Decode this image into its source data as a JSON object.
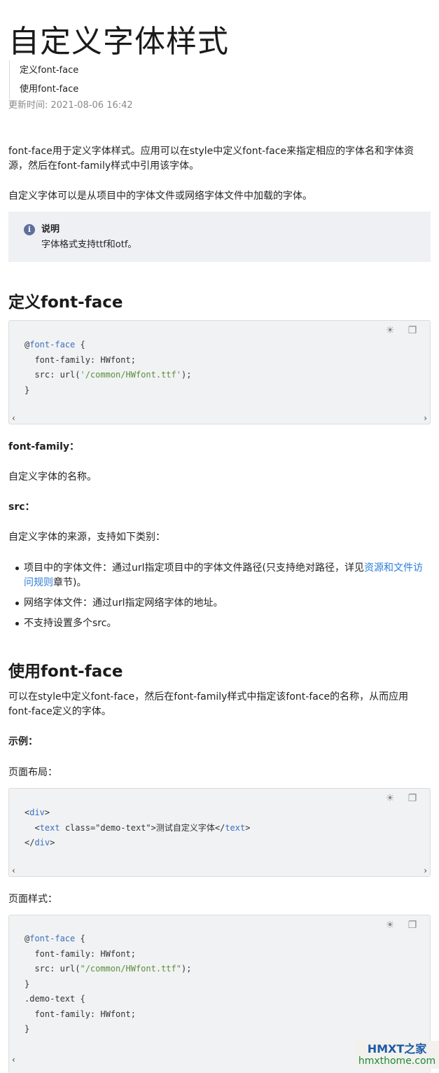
{
  "title": "自定义字体样式",
  "toc": [
    "定义font-face",
    "使用font-face"
  ],
  "updated": "更新时间: 2021-08-06 16:42",
  "intro": {
    "p1": "font-face用于定义字体样式。应用可以在style中定义font-face来指定相应的字体名和字体资源，然后在font-family样式中引用该字体。",
    "p2": "自定义字体可以是从项目中的字体文件或网络字体文件中加载的字体。"
  },
  "note": {
    "icon": "info-icon",
    "title": "说明",
    "text": "字体格式支持ttf和otf。"
  },
  "section1": {
    "heading": "定义font-face",
    "code": {
      "at": "@",
      "rule": "font-face",
      "open": " {",
      "line2": "  font-family: HWfont;",
      "line3_a": "  src: url(",
      "line3_str": "'/common/HWfont.ttf'",
      "line3_b": ");",
      "close": "}"
    },
    "ff_label": "font-family：",
    "ff_desc": "自定义字体的名称。",
    "src_label": "src：",
    "src_desc": "自定义字体的来源，支持如下类别：",
    "bullets": {
      "b1_a": "项目中的字体文件：通过url指定项目中的字体文件路径(只支持绝对路径，详见",
      "b1_link": "资源和文件访问规则",
      "b1_b": "章节)。",
      "b2": "网络字体文件：通过url指定网络字体的地址。",
      "b3": "不支持设置多个src。"
    }
  },
  "section2": {
    "heading": "使用font-face",
    "desc": "可以在style中定义font-face，然后在font-family样式中指定该font-face的名称，从而应用font-face定义的字体。",
    "example_label": "示例：",
    "layout_label": "页面布局：",
    "code_layout": {
      "lt1": "<",
      "div_open": "div",
      "gt1": ">",
      "lt2": "  <",
      "text_open": "text",
      "attr": " class=\"demo-text\">测试自定义字体</",
      "text_close": "text",
      "gt2": ">",
      "lt3": "</",
      "div_close": "div",
      "gt3": ">"
    },
    "style_label": "页面样式：",
    "code_style": {
      "at": "@",
      "rule": "font-face",
      "open": " {",
      "line2": "  font-family: HWfont;",
      "line3_a": "  src: url(",
      "line3_str": "\"/common/HWfont.ttf\"",
      "line3_b": ");",
      "close1": "}",
      "line5": ".demo-text {",
      "line6": "  font-family: HWfont;",
      "close2": "}"
    }
  },
  "code_tools": {
    "theme_icon": "sun-icon",
    "copy_icon": "copy-icon",
    "scroll_left": "‹",
    "scroll_right": "›"
  },
  "watermark": {
    "line1": "HMXT之家",
    "line2": "hmxthome.com"
  }
}
